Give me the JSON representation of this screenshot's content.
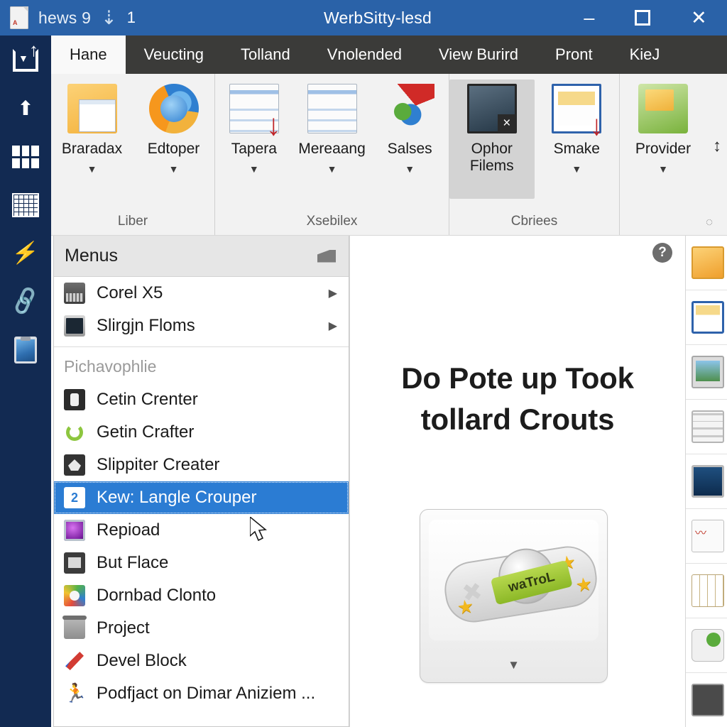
{
  "titlebar": {
    "doc_icon": "pdf-document-icon",
    "doc_name": "hews 9",
    "download_icon": "download-arrow-icon",
    "count": "1",
    "title": "WerbSitty-lesd",
    "minimize": "–",
    "maximize": "maximize-icon",
    "close": "✕"
  },
  "rail": {
    "items": [
      {
        "icon": "export-box-icon"
      },
      {
        "icon": "upload-arrow-icon"
      },
      {
        "icon": "windows-grid-icon"
      },
      {
        "icon": "spreadsheet-icon"
      },
      {
        "icon": "lightning-bolt-icon"
      },
      {
        "icon": "link-chain-icon"
      },
      {
        "icon": "clipboard-image-icon"
      }
    ]
  },
  "ribbon": {
    "tabs": [
      {
        "label": "Hane",
        "active": true
      },
      {
        "label": "Veucting",
        "active": false
      },
      {
        "label": "Tolland",
        "active": false
      },
      {
        "label": "Vnolended",
        "active": false
      },
      {
        "label": "View Burird",
        "active": false
      },
      {
        "label": "Pront",
        "active": false
      },
      {
        "label": "KieJ",
        "active": false
      }
    ],
    "groups": [
      {
        "label": "Liber",
        "buttons": [
          {
            "label": "Braradax",
            "icon": "folder-document-icon",
            "caret": "▼",
            "selected": false
          },
          {
            "label": "Edtoper",
            "icon": "globe-browser-icon",
            "caret": "▼",
            "selected": false
          }
        ]
      },
      {
        "label": "Xsebilex",
        "buttons": [
          {
            "label": "Tapera",
            "icon": "page-download-icon",
            "caret": "▼",
            "selected": false
          },
          {
            "label": "Mereaang",
            "icon": "document-lines-icon",
            "caret": "▼",
            "selected": false
          },
          {
            "label": "Salses",
            "icon": "paint-palette-icon",
            "caret": "▼",
            "selected": false
          }
        ]
      },
      {
        "label": "Cbriees",
        "buttons": [
          {
            "label": "Ophor Filems",
            "icon": "dark-window-close-icon",
            "caret": "",
            "selected": true
          },
          {
            "label": "Smake",
            "icon": "presentation-download-icon",
            "caret": "▼",
            "selected": false
          }
        ]
      },
      {
        "label": "",
        "buttons": [
          {
            "label": "Provider",
            "icon": "green-folder-icon",
            "caret": "▼",
            "selected": false
          }
        ]
      }
    ],
    "updown_icon": "up-down-arrow-icon",
    "dialog_launcher_icon": "dialog-launcher-icon"
  },
  "menus_panel": {
    "title": "Menus",
    "header_icon": "collapse-panel-icon",
    "top_items": [
      {
        "label": "Corel X5",
        "icon": "corel-icon",
        "arrow": "▶"
      },
      {
        "label": "Slirgjn Floms",
        "icon": "phone-icon",
        "arrow": "▶"
      }
    ],
    "group_heading": "Pichavophlie",
    "items": [
      {
        "label": "Cetin Crenter",
        "icon": "cetin-icon",
        "badge": "",
        "selected": false
      },
      {
        "label": "Getin Crafter",
        "icon": "getin-icon",
        "badge": "",
        "selected": false
      },
      {
        "label": "Slippiter Creater",
        "icon": "slippiter-icon",
        "badge": "",
        "selected": false
      },
      {
        "label": "Kew: Langle Crouper",
        "icon": "badge-icon",
        "badge": "2",
        "selected": true
      },
      {
        "label": "Repioad",
        "icon": "repioad-icon",
        "badge": "",
        "selected": false
      },
      {
        "label": "But Flace",
        "icon": "but-flace-icon",
        "badge": "",
        "selected": false
      },
      {
        "label": "Dornbad Clonto",
        "icon": "dornbad-icon",
        "badge": "",
        "selected": false
      },
      {
        "label": "Project",
        "icon": "trash-icon",
        "badge": "",
        "selected": false
      },
      {
        "label": "Devel Block",
        "icon": "devel-block-icon",
        "badge": "",
        "selected": false
      },
      {
        "label": "Podfjact on Dimar Aniziem ...",
        "icon": "podfjact-icon",
        "badge": "",
        "selected": false
      }
    ]
  },
  "content": {
    "help_icon": "?",
    "title_line1": "Do Pote up Took",
    "title_line2": "tollard Crouts",
    "gallery_button": {
      "tag_text": "waTroL",
      "caret": "▼",
      "icon": "pill-badge-thumbnail"
    }
  },
  "right_strip": {
    "items": [
      {
        "icon": "orange-folder-thumb"
      },
      {
        "icon": "blue-presentation-thumb"
      },
      {
        "icon": "monitor-photo-thumb"
      },
      {
        "icon": "lined-card-thumb"
      },
      {
        "icon": "dark-screen-thumb"
      },
      {
        "icon": "chart-sheet-thumb"
      },
      {
        "icon": "grid-tan-thumb"
      },
      {
        "icon": "refresh-badge-thumb"
      },
      {
        "icon": "dark-tile-thumb"
      }
    ]
  },
  "colors": {
    "titlebar": "#2a62a8",
    "rail": "#122a52",
    "tabstrip": "#3b3b39",
    "ribbon": "#f2f2f2",
    "highlight": "#2b7cd3",
    "selected_button": "#d3d3d3"
  }
}
